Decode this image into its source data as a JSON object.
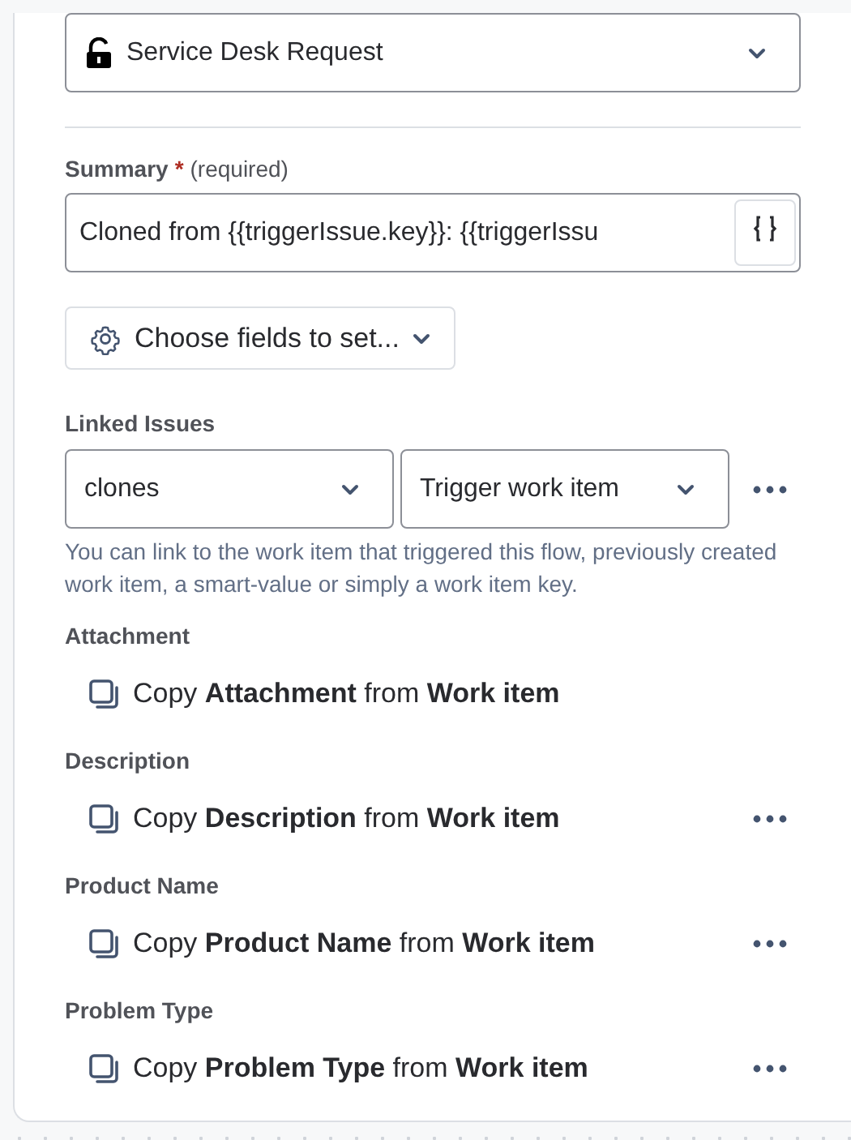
{
  "request_type": {
    "value": "Service Desk Request"
  },
  "summary": {
    "label": "Summary",
    "required_mark": "*",
    "hint": "(required)",
    "value": "Cloned from {{triggerIssue.key}}: {{triggerIssu"
  },
  "choose_fields": {
    "label": "Choose fields to set..."
  },
  "linked_issues": {
    "label": "Linked Issues",
    "link_type": "clones",
    "target": "Trigger work item",
    "help": "You can link to the work item that triggered this flow, previously created work item, a smart-value or simply a work item key."
  },
  "fields": [
    {
      "label": "Attachment",
      "text": "Copy **Attachment** from **Work item**",
      "more_button": false
    },
    {
      "label": "Description",
      "text": "Copy **Description** from **Work item**",
      "more_button": true
    },
    {
      "label": "Product Name",
      "text": "Copy **Product Name** from **Work item**",
      "more_button": true
    },
    {
      "label": "Problem Type",
      "text": "Copy **Problem Type** from **Work item**",
      "more_button": true
    }
  ]
}
